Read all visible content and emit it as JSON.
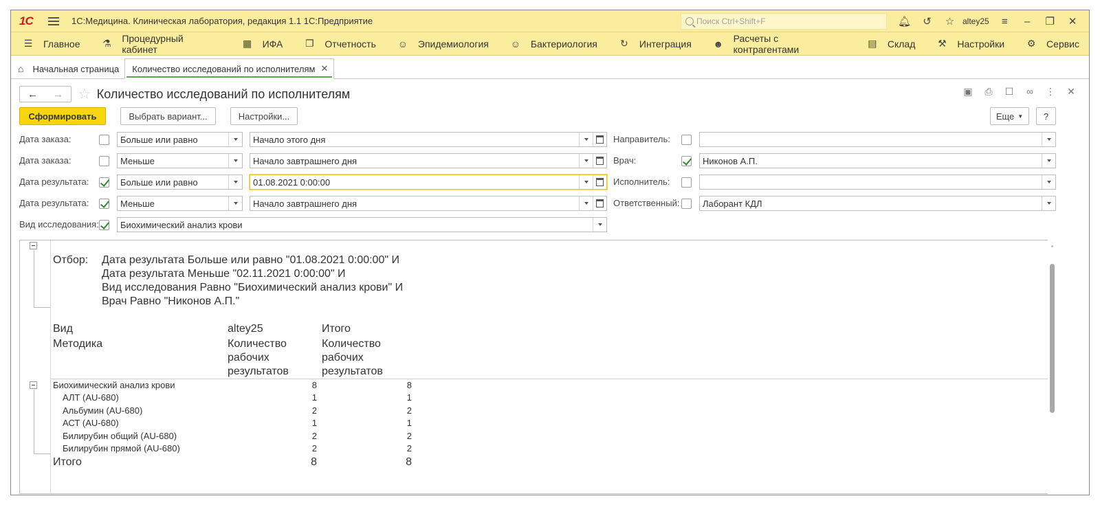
{
  "app": {
    "logo": "1С",
    "title": "1С:Медицина. Клиническая лаборатория, редакция 1.1 1С:Предприятие",
    "search_placeholder": "Поиск Ctrl+Shift+F",
    "username": "altey25"
  },
  "sections": [
    {
      "label": "Главное",
      "icon": "menu-icon"
    },
    {
      "label": "Процедурный кабинет",
      "icon": "test-tube-icon"
    },
    {
      "label": "ИФА",
      "icon": "grid-icon"
    },
    {
      "label": "Отчетность",
      "icon": "documents-icon"
    },
    {
      "label": "Эпидемиология",
      "icon": "virus-icon"
    },
    {
      "label": "Бактериология",
      "icon": "bacteria-icon"
    },
    {
      "label": "Интеграция",
      "icon": "sync-icon"
    },
    {
      "label": "Расчеты с контрагентами",
      "icon": "people-icon"
    },
    {
      "label": "Склад",
      "icon": "warehouse-icon"
    },
    {
      "label": "Настройки",
      "icon": "wrench-icon"
    },
    {
      "label": "Сервис",
      "icon": "gear-icon"
    }
  ],
  "tabs": {
    "home": "Начальная страница",
    "active": "Количество исследований по исполнителям"
  },
  "form": {
    "title": "Количество исследований по исполнителям",
    "generate_btn": "Сформировать",
    "variant_btn": "Выбрать вариант...",
    "settings_btn": "Настройки...",
    "more_btn": "Еще",
    "help_btn": "?"
  },
  "filters_left": [
    {
      "label": "Дата заказа:",
      "checked": false,
      "condition": "Больше или равно",
      "value": "Начало этого дня"
    },
    {
      "label": "Дата заказа:",
      "checked": false,
      "condition": "Меньше",
      "value": "Начало завтрашнего дня"
    },
    {
      "label": "Дата результата:",
      "checked": true,
      "condition": "Больше или равно",
      "value": "01.08.2021  0:00:00"
    },
    {
      "label": "Дата результата:",
      "checked": true,
      "condition": "Меньше",
      "value": "Начало завтрашнего дня"
    }
  ],
  "filter_kind": {
    "label": "Вид исследования:",
    "checked": true,
    "value": "Биохимический анализ крови"
  },
  "filters_right": [
    {
      "label": "Направитель:",
      "checked": false,
      "value": ""
    },
    {
      "label": "Врач:",
      "checked": true,
      "value": "Никонов А.П."
    },
    {
      "label": "Исполнитель:",
      "checked": false,
      "value": ""
    },
    {
      "label": "Ответственный:",
      "checked": false,
      "value": "Лаборант КДЛ"
    }
  ],
  "report": {
    "filter_label": "Отбор:",
    "filter_lines": [
      "Дата результата Больше или равно \"01.08.2021 0:00:00\" И",
      "Дата результата Меньше \"02.11.2021 0:00:00\" И",
      "Вид исследования Равно \"Биохимический анализ крови\" И",
      "Врач Равно \"Никонов А.П.\""
    ],
    "col_kind": "Вид",
    "col_method": "Методика",
    "col_user": "altey25",
    "col_total": "Итого",
    "col_metric": [
      "Количество",
      "рабочих",
      "результатов"
    ],
    "group": {
      "name": "Биохимический анализ крови",
      "user": "8",
      "total": "8"
    },
    "rows": [
      {
        "name": "АЛТ (AU-680)",
        "user": "1",
        "total": "1"
      },
      {
        "name": "Альбумин (AU-680)",
        "user": "2",
        "total": "2"
      },
      {
        "name": "АСТ (AU-680)",
        "user": "1",
        "total": "1"
      },
      {
        "name": "Билирубин общий (AU-680)",
        "user": "2",
        "total": "2"
      },
      {
        "name": "Билирубин прямой (AU-680)",
        "user": "2",
        "total": "2"
      }
    ],
    "grand": {
      "name": "Итого",
      "user": "8",
      "total": "8"
    }
  }
}
